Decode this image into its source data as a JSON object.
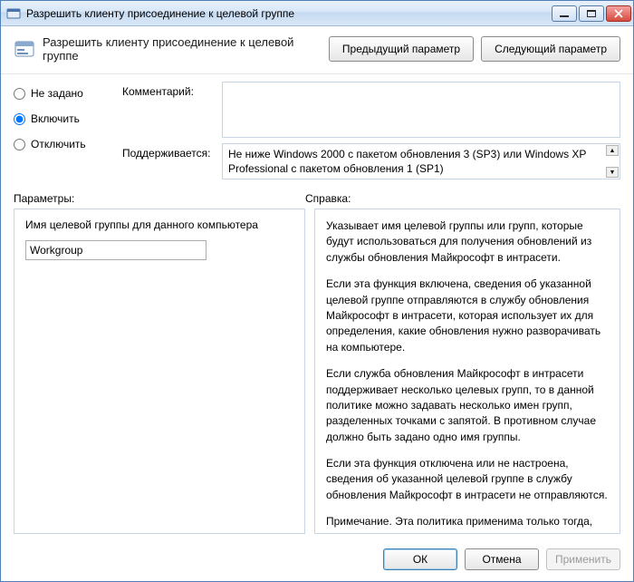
{
  "window": {
    "title": "Разрешить клиенту присоединение к целевой группе"
  },
  "header": {
    "title": "Разрешить клиенту присоединение к целевой группе",
    "prev_label": "Предыдущий параметр",
    "next_label": "Следующий параметр"
  },
  "state": {
    "options": [
      "Не задано",
      "Включить",
      "Отключить"
    ],
    "selected_index": 1
  },
  "fields": {
    "comment_label": "Комментарий:",
    "comment_value": "",
    "supported_label": "Поддерживается:",
    "supported_value": "Не ниже Windows 2000 с пакетом обновления 3 (SP3) или Windows XP Professional с пакетом обновления 1 (SP1)"
  },
  "sections": {
    "params_label": "Параметры:",
    "help_label": "Справка:"
  },
  "params": {
    "param1_label": "Имя целевой группы для данного компьютера",
    "param1_value": "Workgroup"
  },
  "help": {
    "p1": "Указывает имя целевой группы или групп, которые будут использоваться для получения обновлений из службы обновления Майкрософт в интрасети.",
    "p2": "Если эта функция включена, сведения об указанной целевой группе отправляются в службу обновления Майкрософт в интрасети, которая использует их для определения, какие обновления нужно разворачивать на компьютере.",
    "p3": "Если служба обновления Майкрософт в интрасети поддерживает несколько целевых групп, то в данной политике можно задавать несколько имен групп, разделенных точками с запятой. В противном случае должно быть задано одно имя группы.",
    "p4": "Если эта функция отключена или не настроена, сведения об указанной целевой группе в службу обновления Майкрософт в интрасети не отправляются.",
    "p5": "Примечание. Эта политика применима только тогда, когда"
  },
  "footer": {
    "ok": "ОК",
    "cancel": "Отмена",
    "apply": "Применить"
  }
}
